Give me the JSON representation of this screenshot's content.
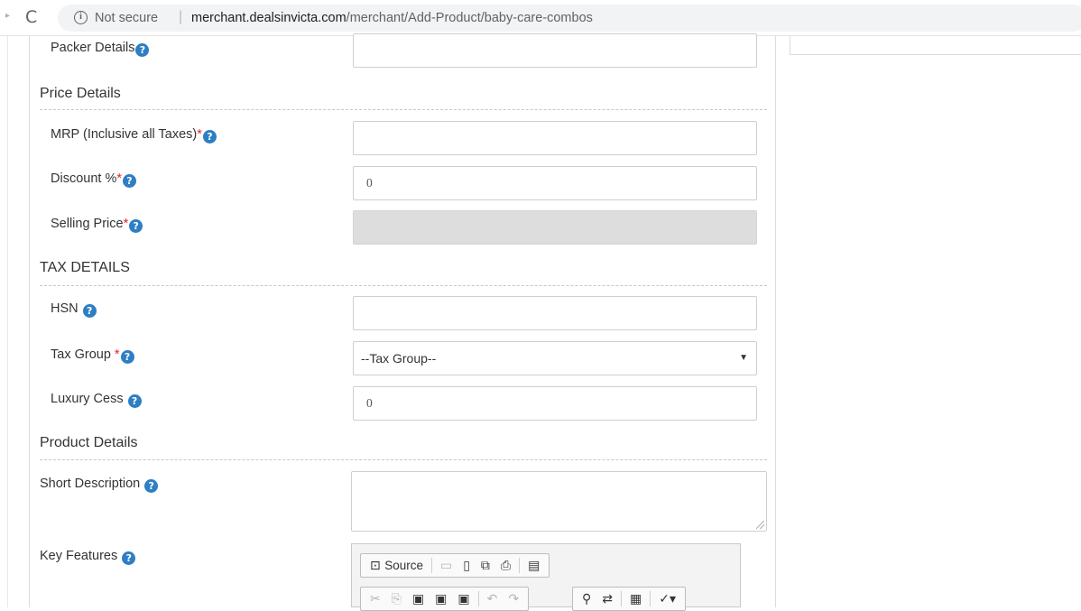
{
  "browser": {
    "forward_glyph": "▸",
    "reload_glyph": "C",
    "info_glyph": "i",
    "security_text": "Not secure",
    "separator": "|",
    "url_host": "merchant.dealsinvicta.com",
    "url_path": "/merchant/Add-Product/baby-care-combos"
  },
  "help_glyph": "?",
  "required_mark": "*",
  "form": {
    "packer_details": {
      "label": "Packer Details",
      "value": ""
    },
    "sections": {
      "price": "Price Details",
      "tax": "TAX DETAILS",
      "product": "Product Details"
    },
    "mrp": {
      "label": "MRP (Inclusive all Taxes)",
      "value": ""
    },
    "discount": {
      "label": "Discount %",
      "value": "0"
    },
    "selling_price": {
      "label": "Selling Price",
      "value": ""
    },
    "hsn": {
      "label": "HSN",
      "value": ""
    },
    "tax_group": {
      "label": "Tax Group ",
      "selected": "--Tax Group--",
      "arrow": "▼"
    },
    "luxury_cess": {
      "label": "Luxury Cess",
      "value": "0"
    },
    "short_description": {
      "label": "Short Description",
      "value": ""
    },
    "key_features": {
      "label": "Key Features"
    }
  },
  "editor": {
    "row1": {
      "source_icon": "⊡",
      "source_label": "Source",
      "save_icon": "▭",
      "new_page_icon": "▯",
      "preview_icon": "⧉",
      "print_icon": "⎙",
      "templates_icon": "▤"
    },
    "row2": {
      "cut_icon": "✂",
      "copy_icon": "⎘",
      "paste_icon": "▣",
      "paste_text_icon": "▣",
      "paste_word_icon": "▣",
      "undo_icon": "↶",
      "redo_icon": "↷",
      "find_icon": "⚲",
      "replace_icon": "⇄",
      "select_all_icon": "▦",
      "spell_icon": "✓▾"
    }
  },
  "colors": {
    "help_icon": "#2d7ec3",
    "required": "#e0262b",
    "disabled_field": "#dddddd"
  }
}
